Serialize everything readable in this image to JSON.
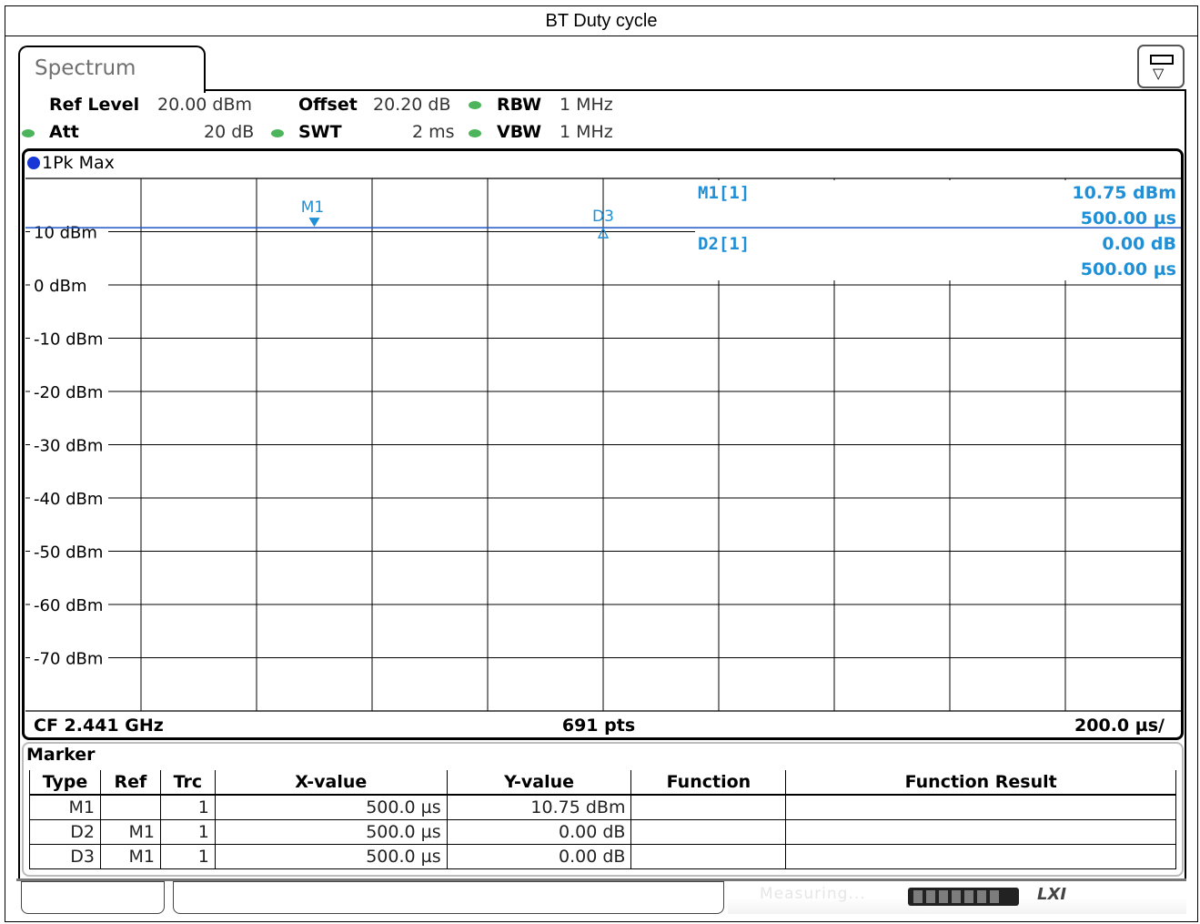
{
  "window": {
    "caption": "BT Duty cycle"
  },
  "tab": {
    "label": "Spectrum"
  },
  "params": {
    "ref_level_label": "Ref Level",
    "ref_level_value": "20.00 dBm",
    "offset_label": "Offset",
    "offset_value": "20.20 dB",
    "rbw_label": "RBW",
    "rbw_value": "1 MHz",
    "att_label": "Att",
    "att_value": "20 dB",
    "swt_label": "SWT",
    "swt_value": "2 ms",
    "vbw_label": "VBW",
    "vbw_value": "1 MHz"
  },
  "trace": {
    "label": "1Pk Max"
  },
  "footer": {
    "cf": "CF 2.441 GHz",
    "points": "691 pts",
    "span_per_div": "200.0 µs/"
  },
  "marker_info": {
    "m1_label": "M1[1]",
    "m1_level": "10.75 dBm",
    "m1_time": "500.00 µs",
    "d2_label": "D2[1]",
    "d2_level": "0.00 dB",
    "d2_time": "500.00 µs"
  },
  "marker_table": {
    "title": "Marker",
    "headers": [
      "Type",
      "Ref",
      "Trc",
      "X-value",
      "Y-value",
      "Function",
      "Function Result"
    ],
    "rows": [
      [
        "M1",
        "",
        "1",
        "500.0 µs",
        "10.75 dBm",
        "",
        ""
      ],
      [
        "D2",
        "M1",
        "1",
        "500.0 µs",
        "0.00 dB",
        "",
        ""
      ],
      [
        "D3",
        "M1",
        "1",
        "500.0 µs",
        "0.00 dB",
        "",
        ""
      ]
    ]
  },
  "status": {
    "measuring": "Measuring...",
    "lxi": "LXI"
  },
  "colors": {
    "trace": "#1f56c8",
    "marker": "#1f8fd6",
    "led": "#4cb45a"
  },
  "chart_data": {
    "type": "line",
    "title": "",
    "x_unit": "µs",
    "x_range": [
      0,
      2000
    ],
    "x_div": 200,
    "ylim": [
      -80,
      20
    ],
    "y_ticks": [
      {
        "value": 10,
        "label": "10 dBm"
      },
      {
        "value": 0,
        "label": "0 dBm"
      },
      {
        "value": -10,
        "label": "-10 dBm"
      },
      {
        "value": -20,
        "label": "-20 dBm"
      },
      {
        "value": -30,
        "label": "-30 dBm"
      },
      {
        "value": -40,
        "label": "-40 dBm"
      },
      {
        "value": -50,
        "label": "-50 dBm"
      },
      {
        "value": -60,
        "label": "-60 dBm"
      },
      {
        "value": -70,
        "label": "-70 dBm"
      }
    ],
    "grid": true,
    "series": [
      {
        "name": "1Pk Max",
        "x": [
          0,
          2000
        ],
        "y": [
          10.75,
          10.75
        ]
      }
    ],
    "markers": [
      {
        "label": "M1",
        "x": 500,
        "y": 10.75,
        "shape": "filled-down"
      },
      {
        "label": "D3",
        "x": 1000,
        "y": 10.75,
        "shape": "open-up"
      }
    ]
  }
}
